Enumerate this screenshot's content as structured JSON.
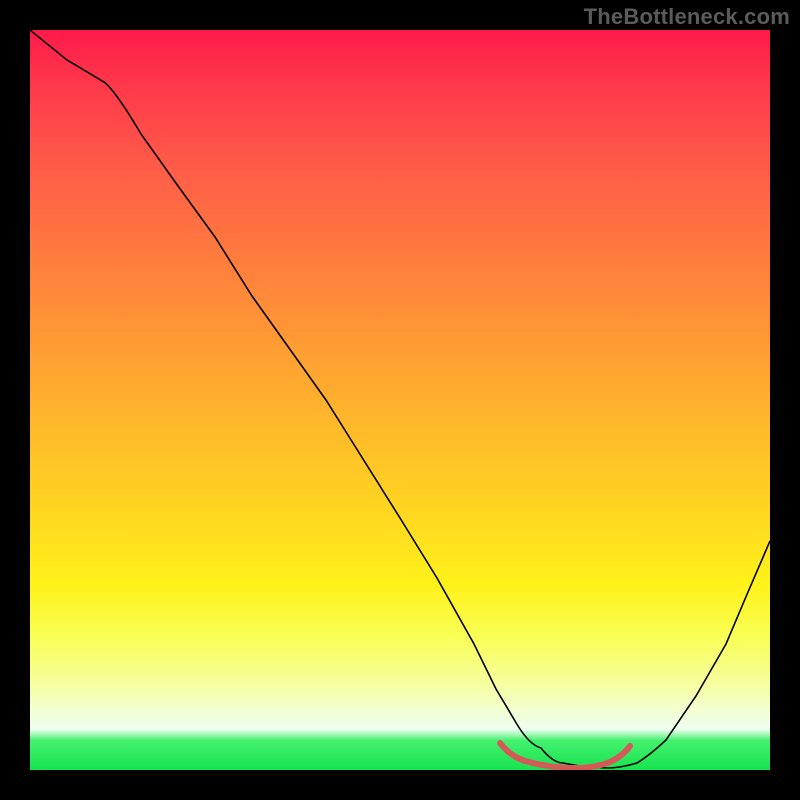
{
  "watermark": "TheBottleneck.com",
  "chart_data": {
    "type": "line",
    "title": "",
    "xlabel": "",
    "ylabel": "",
    "xlim": [
      0,
      100
    ],
    "ylim": [
      0,
      100
    ],
    "series": [
      {
        "name": "curve",
        "x": [
          0,
          5,
          10,
          15,
          20,
          25,
          30,
          35,
          40,
          45,
          50,
          55,
          60,
          63,
          66,
          69,
          72,
          75,
          78,
          82,
          86,
          90,
          94,
          97,
          100
        ],
        "values": [
          100,
          96,
          93,
          86,
          79,
          72,
          64,
          57,
          50,
          42,
          34,
          26,
          17,
          11,
          6,
          3,
          1,
          0,
          0,
          1,
          4,
          10,
          17,
          24,
          31
        ]
      }
    ],
    "highlight_range_x": [
      63,
      80
    ],
    "colors": {
      "curve": "#000000",
      "marker": "#d45a5a",
      "gradient_top": "#ff1a4b",
      "gradient_bottom": "#17e34e"
    }
  }
}
